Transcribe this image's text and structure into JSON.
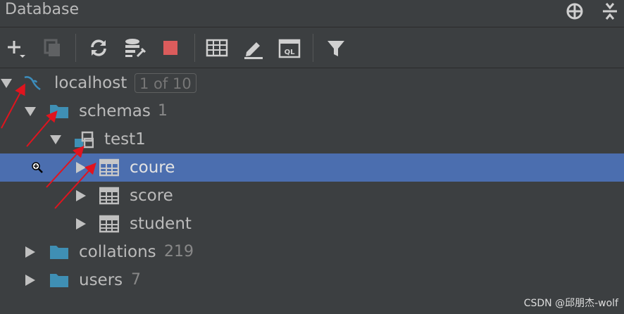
{
  "header": {
    "title": "Database"
  },
  "tree": {
    "localhost": {
      "label": "localhost",
      "badge": "1 of 10"
    },
    "schemas": {
      "label": "schemas",
      "count": "1"
    },
    "test1": {
      "label": "test1"
    },
    "tables": [
      {
        "label": "coure",
        "selected": true
      },
      {
        "label": "score"
      },
      {
        "label": "student"
      }
    ],
    "collations": {
      "label": "collations",
      "count": "219"
    },
    "users": {
      "label": "users",
      "count": "7"
    }
  },
  "watermark": "CSDN @邱朋杰-wolf",
  "colors": {
    "background": "#3c3f41",
    "selection": "#4b6eaf",
    "folder": "#3f8fb4",
    "stop": "#db5c5c",
    "annotation_arrow": "#e0141e"
  }
}
